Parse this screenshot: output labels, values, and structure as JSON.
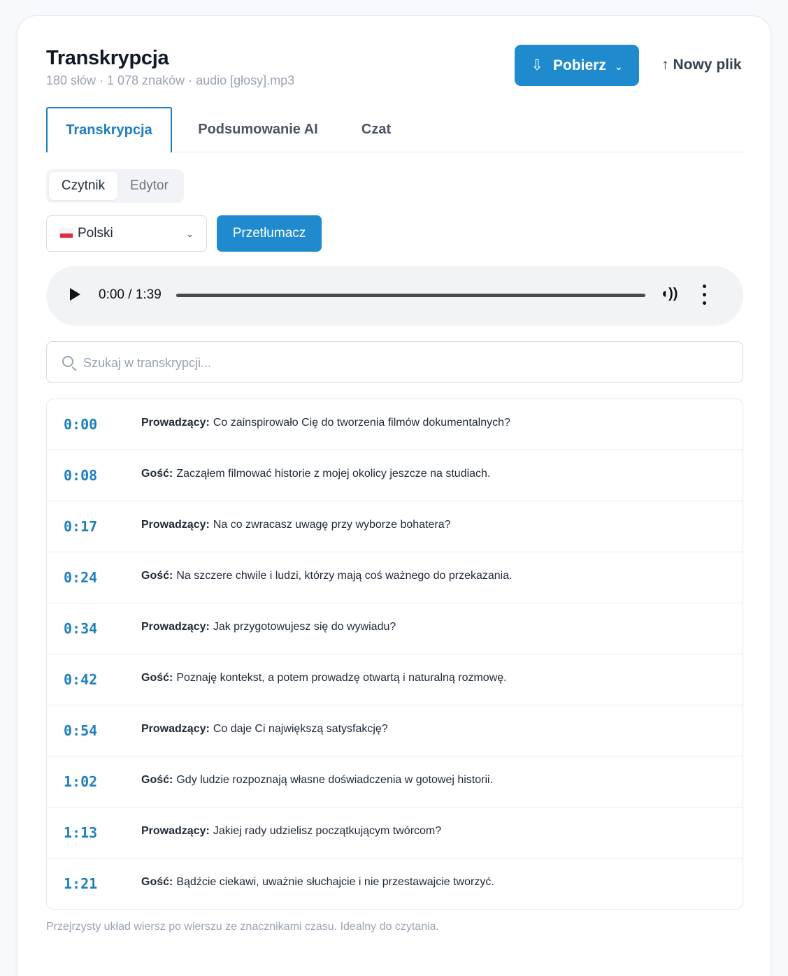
{
  "header": {
    "title": "Transkrypcja",
    "subtitle": "180 słów · 1 078 znaków · audio [głosy].mp3",
    "download_label": "Pobierz",
    "new_file_label": "Nowy plik"
  },
  "tabs": [
    {
      "label": "Transkrypcja",
      "active": true
    },
    {
      "label": "Podsumowanie AI",
      "active": false
    },
    {
      "label": "Czat",
      "active": false
    }
  ],
  "view_mode": {
    "options": [
      "Czytnik",
      "Edytor"
    ],
    "selected": "Czytnik"
  },
  "language": {
    "selected": "Polski",
    "translate_label": "Przetłumacz"
  },
  "player": {
    "time": "0:00 / 1:39",
    "progress": 0
  },
  "search": {
    "placeholder": "Szukaj w transkrypcji..."
  },
  "transcript": [
    {
      "time": "0:00",
      "speaker": "Prowadzący:",
      "text": "Co zainspirowało Cię do tworzenia filmów dokumentalnych?"
    },
    {
      "time": "0:08",
      "speaker": "Gość:",
      "text": "Zacząłem filmować historie z mojej okolicy jeszcze na studiach."
    },
    {
      "time": "0:17",
      "speaker": "Prowadzący:",
      "text": "Na co zwracasz uwagę przy wyborze bohatera?"
    },
    {
      "time": "0:24",
      "speaker": "Gość:",
      "text": "Na szczere chwile i ludzi, którzy mają coś ważnego do przekazania."
    },
    {
      "time": "0:34",
      "speaker": "Prowadzący:",
      "text": "Jak przygotowujesz się do wywiadu?"
    },
    {
      "time": "0:42",
      "speaker": "Gość:",
      "text": "Poznaję kontekst, a potem prowadzę otwartą i naturalną rozmowę."
    },
    {
      "time": "0:54",
      "speaker": "Prowadzący:",
      "text": "Co daje Ci największą satysfakcję?"
    },
    {
      "time": "1:02",
      "speaker": "Gość:",
      "text": "Gdy ludzie rozpoznają własne doświadczenia w gotowej historii."
    },
    {
      "time": "1:13",
      "speaker": "Prowadzący:",
      "text": "Jakiej rady udzielisz początkującym twórcom?"
    },
    {
      "time": "1:21",
      "speaker": "Gość:",
      "text": "Bądźcie ciekawi, uważnie słuchajcie i nie przestawajcie tworzyć."
    }
  ],
  "footnote": "Przejrzysty układ wiersz po wierszu ze znacznikami czasu. Idealny do czytania.",
  "colors": {
    "accent": "#1f8bce",
    "timestamp": "#1f7fbd",
    "muted": "#9aa3b2"
  }
}
